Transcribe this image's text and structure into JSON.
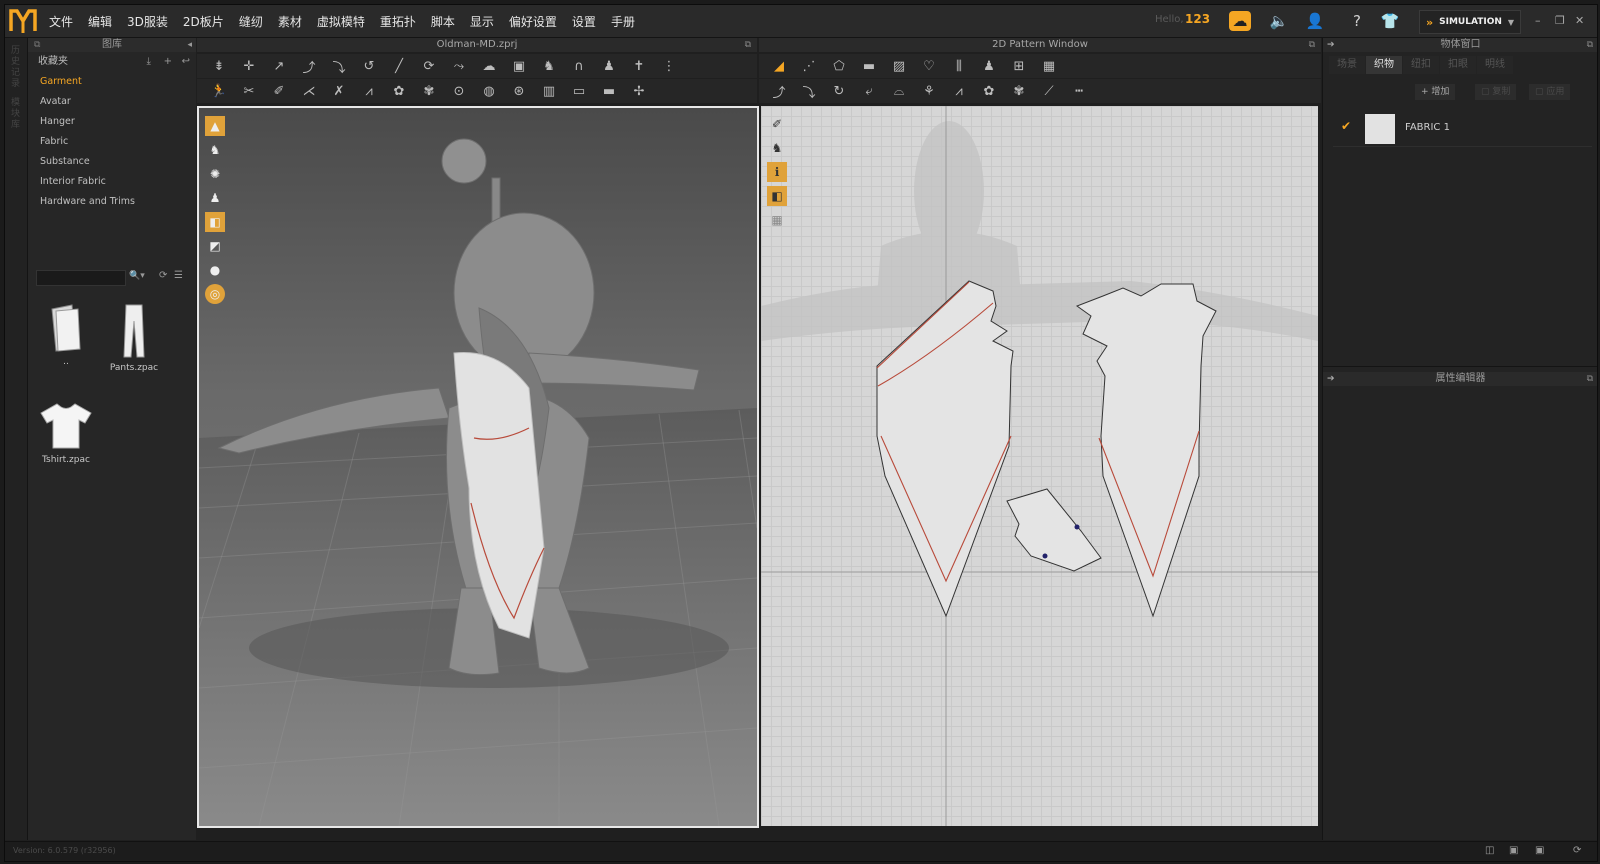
{
  "menubar": {
    "items": [
      "文件",
      "编辑",
      "3D服装",
      "2D板片",
      "缝纫",
      "素材",
      "虚拟模特",
      "重拓扑",
      "脚本",
      "显示",
      "偏好设置",
      "设置",
      "手册"
    ],
    "hello": "Hello,",
    "username": "123",
    "mode": "SIMULATION"
  },
  "left_strip": {
    "labels": [
      "历史记录",
      "模块库"
    ]
  },
  "library": {
    "title": "图库",
    "favorites_label": "收藏夹",
    "items": [
      "Garment",
      "Avatar",
      "Hanger",
      "Fabric",
      "Substance",
      "Interior Fabric",
      "Hardware and Trims"
    ],
    "active_item": "Garment",
    "search_placeholder": "",
    "files": [
      {
        "label": "..",
        "icon": "folder-icon"
      },
      {
        "label": "Pants.zpac",
        "icon": "pants-icon"
      },
      {
        "label": "Tshirt.zpac",
        "icon": "tshirt-icon"
      }
    ]
  },
  "window3d": {
    "title": "Oldman-MD.zprj"
  },
  "window2d": {
    "title": "2D Pattern Window"
  },
  "object_browser": {
    "title": "物体窗口",
    "tabs": [
      "场景",
      "织物",
      "纽扣",
      "扣眼",
      "明线"
    ],
    "active_tab": "织物",
    "actions": {
      "add": "增加",
      "copy": "复制",
      "apply": "应用"
    },
    "fabrics": [
      {
        "name": "FABRIC 1",
        "swatch": "#e2e2e2"
      }
    ]
  },
  "property_editor": {
    "title": "属性编辑器"
  },
  "status": {
    "version": "Version: 6.0.579 (r32956)"
  },
  "colors": {
    "accent": "#f5a623",
    "seam": "#b84a3a",
    "viewport_border": "#e8e8e8"
  }
}
